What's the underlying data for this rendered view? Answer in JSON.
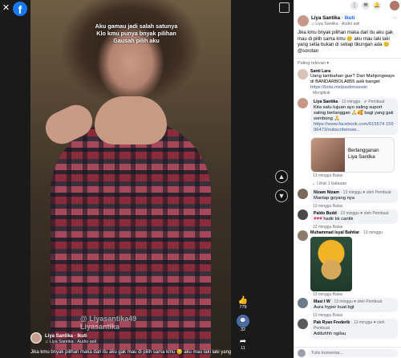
{
  "app": {
    "logo": "f"
  },
  "video": {
    "caption": "Aku gamau jadi salah satunya\nKlo kmu punya bnyak pilihan\nGausah pilih aku",
    "watermark": "@ Liyasantika49\nLiyasantika",
    "likes": "779",
    "comments": "32",
    "shares": "11",
    "author": "Liya Santika",
    "follow": "· Ikuti",
    "audio": "♫ Liya Santika · Audio asli",
    "description": "Jika kmu bnyak pilihan maka dari itu aku gak mau di pilih sama kmu 😊 aku mau laki laki yang setia"
  },
  "panel": {
    "author": "Liya Santika",
    "follow": "· Ikuti",
    "audio": "♫ Liya Santika · Audio asli",
    "post_text": "Jika kmu bnyak pilihan maka dari itu aku gak mau di pilih sama kmu 😊 aku mau laki laki yang setia bukan di setiap tikungan ada 😊 @sorotan",
    "sort_label": "Paling relevan ▾",
    "comments": [
      {
        "name": "Santi Lara",
        "text": "Uang tambahan gue? Dari Mahjongways di BANDARBOLA855 asik banget",
        "link": "https://bola.mx/pastimaswin",
        "meta": "Mengikuti"
      },
      {
        "name": "Liya Santika",
        "badge": "· 13 minggu · ✔ Pembuat",
        "text": "Kita satu tujuan ayo saling suport saling berlanggan 🙏🥰 bagi yang gak sombong 🙏",
        "link": "https://www.facebook.com/615574 15996473/subscribenow...",
        "promo": "Berlangganan\nLiya Santika",
        "meta": "13 minggu   Balas"
      },
      {
        "name": "Nizam Nizam",
        "badge": "· 13 minggu   ♥ oleh Pembuat",
        "text": "Mantap goyang nya",
        "meta": "13 minggu   Balas"
      },
      {
        "name": "Paldo Budd",
        "badge": "· 13 minggu   ♥ oleh Pembuat",
        "text": "hadir kk cantik",
        "meta": "13 minggu   Balas"
      },
      {
        "name": "Muhammad Isyal Bahtiar",
        "badge": "· 13 minggu",
        "meta": "13 minggu   Balas"
      },
      {
        "name": "Masi I W",
        "badge": "· 13 minggu   ♥ oleh Pembuat",
        "text": "Aura hyper kuat bgt",
        "meta": "13 minggu   Balas"
      },
      {
        "name": "Pak Ryan Frederik",
        "badge": "· 13 minggu   ♥ oleh Pembuat",
        "text": "Adduhhh ngiluu",
        "meta": "13 minggu   Balas"
      }
    ],
    "reply_toggle": "⌄ Lihat 1 balasan",
    "comment_placeholder": "Tulis komentar..."
  }
}
